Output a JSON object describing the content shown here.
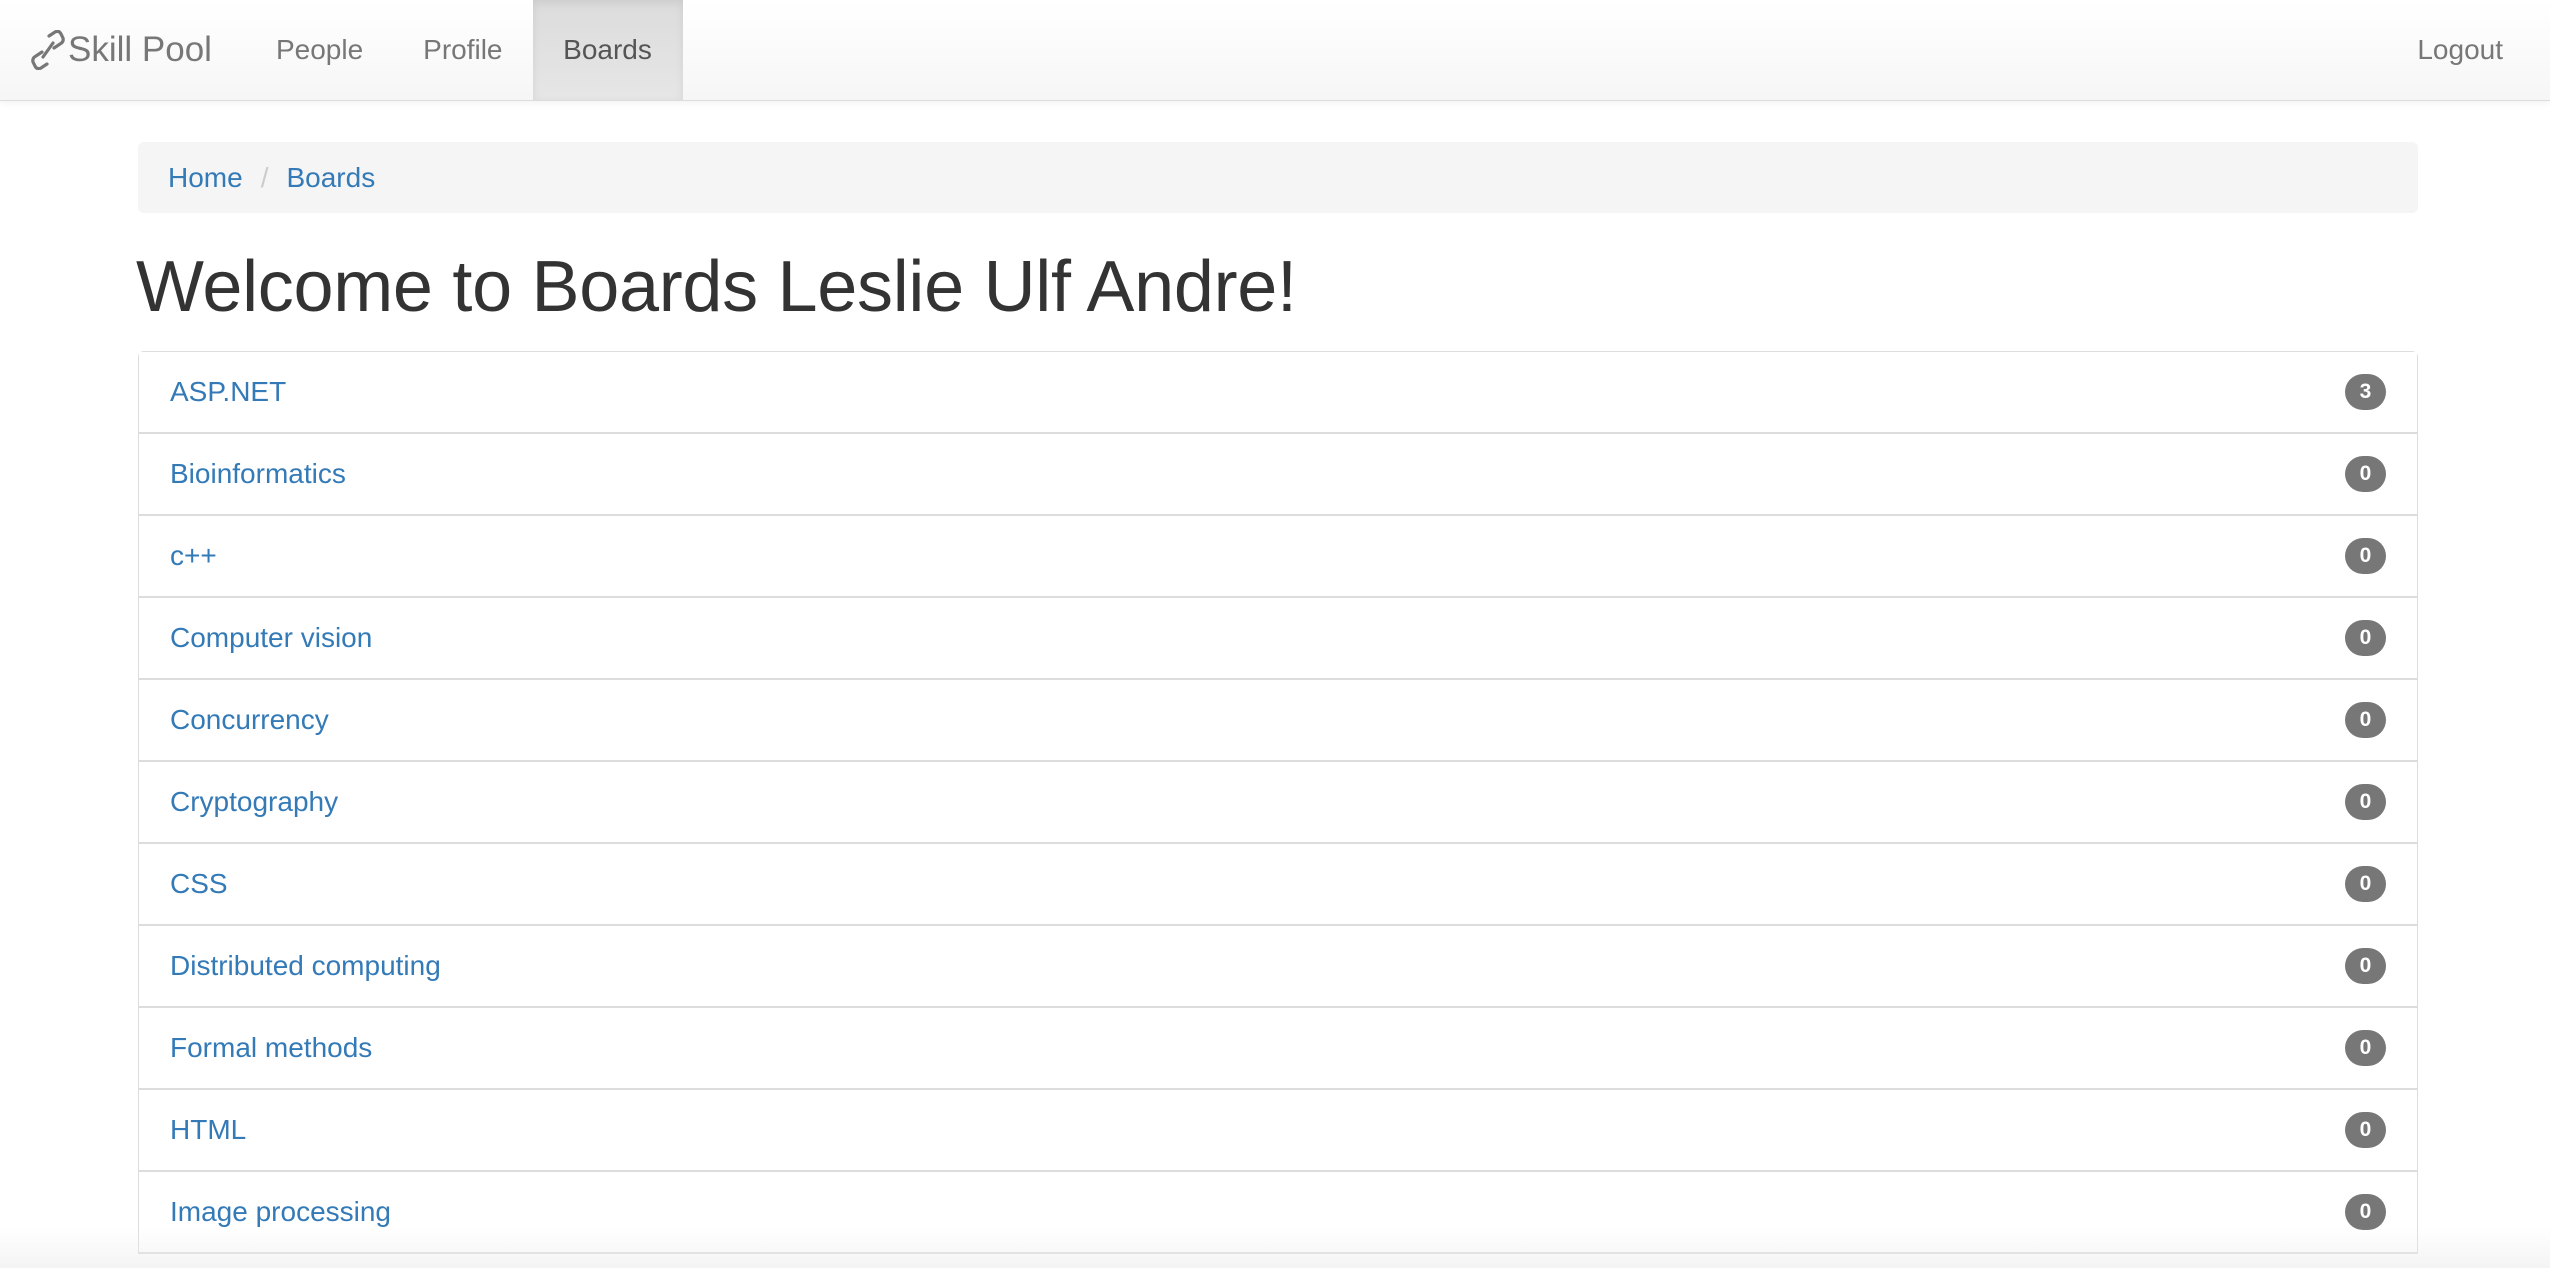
{
  "navbar": {
    "brand": "Skill Pool",
    "brand_icon": "link-icon",
    "items": [
      {
        "label": "People",
        "active": false
      },
      {
        "label": "Profile",
        "active": false
      },
      {
        "label": "Boards",
        "active": true
      }
    ],
    "logout": "Logout"
  },
  "breadcrumb": {
    "items": [
      "Home",
      "Boards"
    ],
    "separator": "/"
  },
  "page": {
    "title": "Welcome to Boards Leslie Ulf Andre!"
  },
  "boards": [
    {
      "name": "ASP.NET",
      "count": "3"
    },
    {
      "name": "Bioinformatics",
      "count": "0"
    },
    {
      "name": "c++",
      "count": "0"
    },
    {
      "name": "Computer vision",
      "count": "0"
    },
    {
      "name": "Concurrency",
      "count": "0"
    },
    {
      "name": "Cryptography",
      "count": "0"
    },
    {
      "name": "CSS",
      "count": "0"
    },
    {
      "name": "Distributed computing",
      "count": "0"
    },
    {
      "name": "Formal methods",
      "count": "0"
    },
    {
      "name": "HTML",
      "count": "0"
    },
    {
      "name": "Image processing",
      "count": "0"
    }
  ],
  "colors": {
    "link": "#337ab7",
    "badge": "#777777",
    "nav_text": "#777777"
  }
}
